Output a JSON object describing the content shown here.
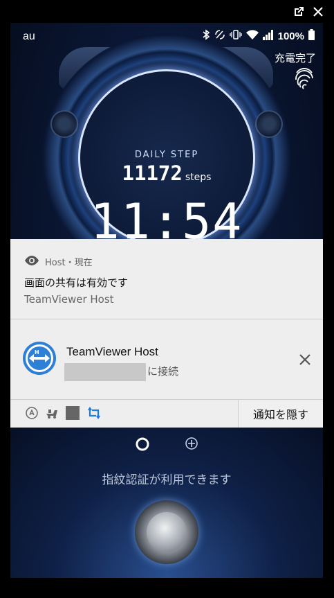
{
  "window": {
    "controls": [
      "external-link-icon",
      "close-icon"
    ]
  },
  "status_bar": {
    "carrier": "au",
    "battery_percent": "100%",
    "charging_text": "充電完了",
    "icons": [
      "bluetooth-icon",
      "nfc-icon",
      "vibrate-icon",
      "wifi-icon",
      "signal-icon",
      "battery-icon"
    ]
  },
  "lockscreen": {
    "daily_step_label": "DAILY STEP",
    "steps_value": "11172",
    "steps_unit": "steps",
    "clock": "11:54",
    "fingerprint_text": "指紋認証が利用できます"
  },
  "notifications": [
    {
      "app": "Host",
      "time": "現在",
      "header": "Host・現在",
      "title": "画面の共有は有効です",
      "subtitle": "TeamViewer Host"
    },
    {
      "title": "TeamViewer Host",
      "subtitle": "に接続",
      "masked": true
    }
  ],
  "actions_bar": {
    "icons": [
      "app-icon-1",
      "app-icon-2",
      "gray-square-icon",
      "sync-icon"
    ],
    "hide_label": "通知を隠す"
  },
  "colors": {
    "accent_blue": "#2e7fd6",
    "panel_bg": "#eeeeee"
  }
}
